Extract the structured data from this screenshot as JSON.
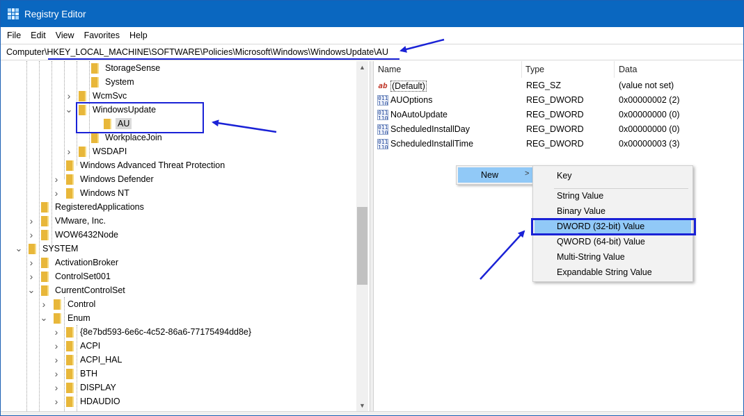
{
  "window": {
    "title": "Registry Editor"
  },
  "menu": [
    "File",
    "Edit",
    "View",
    "Favorites",
    "Help"
  ],
  "address": "Computer\\HKEY_LOCAL_MACHINE\\SOFTWARE\\Policies\\Microsoft\\Windows\\WindowsUpdate\\AU",
  "tree": [
    {
      "label": "StorageSense",
      "chevron": ""
    },
    {
      "label": "System",
      "chevron": ""
    },
    {
      "label": "WcmSvc",
      "chevron": ">"
    },
    {
      "label": "WindowsUpdate",
      "chevron": "v"
    },
    {
      "label": "AU",
      "chevron": "",
      "selected": true
    },
    {
      "label": "WorkplaceJoin",
      "chevron": ""
    },
    {
      "label": "WSDAPI",
      "chevron": ">"
    },
    {
      "label": "Windows Advanced Threat Protection",
      "chevron": ""
    },
    {
      "label": "Windows Defender",
      "chevron": ">"
    },
    {
      "label": "Windows NT",
      "chevron": ">"
    },
    {
      "label": "RegisteredApplications",
      "chevron": ""
    },
    {
      "label": "VMware, Inc.",
      "chevron": ">"
    },
    {
      "label": "WOW6432Node",
      "chevron": ">"
    },
    {
      "label": "SYSTEM",
      "chevron": "v"
    },
    {
      "label": "ActivationBroker",
      "chevron": ">"
    },
    {
      "label": "ControlSet001",
      "chevron": ">"
    },
    {
      "label": "CurrentControlSet",
      "chevron": "v"
    },
    {
      "label": "Control",
      "chevron": ">"
    },
    {
      "label": "Enum",
      "chevron": "v"
    },
    {
      "label": "{8e7bd593-6e6c-4c52-86a6-77175494dd8e}",
      "chevron": ">"
    },
    {
      "label": "ACPI",
      "chevron": ">"
    },
    {
      "label": "ACPI_HAL",
      "chevron": ">"
    },
    {
      "label": "BTH",
      "chevron": ">"
    },
    {
      "label": "DISPLAY",
      "chevron": ">"
    },
    {
      "label": "HDAUDIO",
      "chevron": ">"
    }
  ],
  "columns": {
    "name": "Name",
    "type": "Type",
    "data": "Data"
  },
  "values": [
    {
      "name": "(Default)",
      "type": "REG_SZ",
      "data": "(value not set)",
      "icon": "string-value-icon"
    },
    {
      "name": "AUOptions",
      "type": "REG_DWORD",
      "data": "0x00000002 (2)",
      "icon": "binary-value-icon"
    },
    {
      "name": "NoAutoUpdate",
      "type": "REG_DWORD",
      "data": "0x00000000 (0)",
      "icon": "binary-value-icon"
    },
    {
      "name": "ScheduledInstallDay",
      "type": "REG_DWORD",
      "data": "0x00000000 (0)",
      "icon": "binary-value-icon"
    },
    {
      "name": "ScheduledInstallTime",
      "type": "REG_DWORD",
      "data": "0x00000003 (3)",
      "icon": "binary-value-icon"
    }
  ],
  "context_menu": {
    "new_label": "New",
    "arrow": ">"
  },
  "submenu": [
    "Key",
    "String Value",
    "Binary Value",
    "DWORD (32-bit) Value",
    "QWORD (64-bit) Value",
    "Multi-String Value",
    "Expandable String Value"
  ],
  "colors": {
    "titlebar": "#0a67c0",
    "highlight": "#91c9f7",
    "annotation": "#1a22d6"
  }
}
